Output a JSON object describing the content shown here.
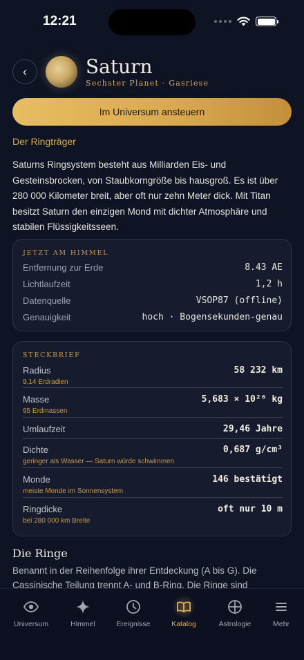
{
  "status": {
    "time": "12:21"
  },
  "header": {
    "back_glyph": "‹",
    "title": "Saturn",
    "subtitle": "Sechster Planet · Gasriese"
  },
  "cta_label": "Im Universum ansteuern",
  "section_heading": "Der Ringträger",
  "intro": "Saturns Ringsystem besteht aus Milliarden Eis- und Gesteinsbrocken, von Staubkorngröße bis hausgroß. Es ist über 280 000 Kilometer breit, aber oft nur zehn Meter dick. Mit Titan besitzt Saturn den einzigen Mond mit dichter Atmosphäre und stabilen Flüssigkeitsseen.",
  "sky_card": {
    "title": "JETZT AM HIMMEL",
    "rows": [
      {
        "label": "Entfernung zur Erde",
        "value": "8.43 AE"
      },
      {
        "label": "Lichtlaufzeit",
        "value": "1,2 h"
      },
      {
        "label": "Datenquelle",
        "value": "VSOP87 (offline)"
      },
      {
        "label": "Genauigkeit",
        "value": "hoch · Bogensekunden-genau"
      }
    ]
  },
  "profile_card": {
    "title": "STECKBRIEF",
    "rows": [
      {
        "label": "Radius",
        "note": "9,14 Erdradien",
        "value": "58 232 km"
      },
      {
        "label": "Masse",
        "note": "95 Erdmassen",
        "value": "5,683 × 10²⁶ kg"
      },
      {
        "label": "Umlaufzeit",
        "note": "",
        "value": "29,46 Jahre"
      },
      {
        "label": "Dichte",
        "note": "geringer als Wasser — Saturn würde schwimmen",
        "value": "0,687 g/cm³"
      },
      {
        "label": "Monde",
        "note": "meiste Monde im Sonnensystem",
        "value": "146 bestätigt"
      },
      {
        "label": "Ringdicke",
        "note": "bei 280 000 km Breite",
        "value": "oft nur 10 m"
      }
    ]
  },
  "rings": {
    "title": "Die Ringe",
    "text": "Benannt in der Reihenfolge ihrer Entdeckung (A bis G). Die Cassinische Teilung trennt A- und B-Ring. Die Ringe sind vermutlich"
  },
  "tabs": [
    {
      "label": "Universum",
      "icon": "eye-icon",
      "active": false
    },
    {
      "label": "Himmel",
      "icon": "sparkle-icon",
      "active": false
    },
    {
      "label": "Ereignisse",
      "icon": "clock-icon",
      "active": false
    },
    {
      "label": "Katalog",
      "icon": "book-icon",
      "active": true
    },
    {
      "label": "Astrologie",
      "icon": "crosshair-icon",
      "active": false
    },
    {
      "label": "Mehr",
      "icon": "menu-icon",
      "active": false
    }
  ],
  "colors": {
    "background": "#0f1424",
    "accent": "#d9a94d",
    "card": "#161c2e"
  }
}
